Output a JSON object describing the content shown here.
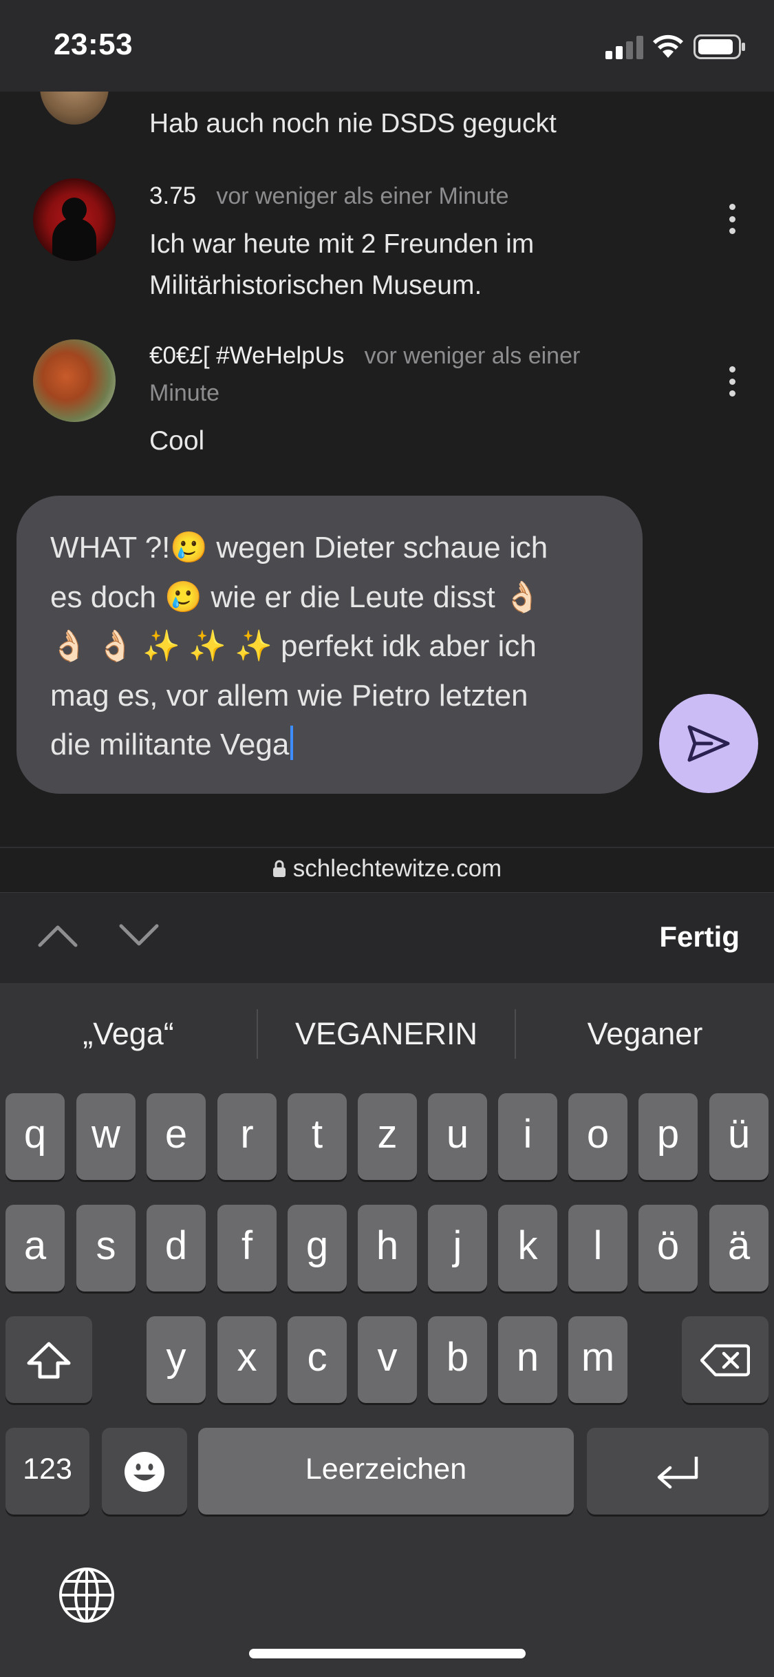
{
  "status_bar": {
    "time": "23:53"
  },
  "comments": [
    {
      "text": "Hab auch noch nie DSDS geguckt"
    },
    {
      "author": "3.75",
      "time": "vor weniger als einer Minute",
      "text_lines": [
        "Ich war heute mit 2 Freunden im",
        "Militärhistorischen Museum."
      ]
    },
    {
      "author": "€0€£[ #WeHelpUs",
      "time_line1": "vor weniger als einer",
      "time_line2": "Minute",
      "text": "Cool"
    }
  ],
  "composer": {
    "lines": [
      "WHAT ?!🥲 wegen Dieter schaue ich",
      "es doch 🥲 wie er die Leute disst 👌🏻",
      "👌🏻 👌🏻 ✨ ✨ ✨ perfekt idk aber ich",
      "mag es, vor allem wie Pietro letzten",
      "die militante Vega"
    ]
  },
  "url_bar": {
    "url": "schlechtewitze.com"
  },
  "accessory": {
    "done_label": "Fertig"
  },
  "keyboard": {
    "suggestions": [
      "„Vega“",
      "VEGANERIN",
      "Veganer"
    ],
    "row1": [
      "q",
      "w",
      "e",
      "r",
      "t",
      "z",
      "u",
      "i",
      "o",
      "p",
      "ü"
    ],
    "row2": [
      "a",
      "s",
      "d",
      "f",
      "g",
      "h",
      "j",
      "k",
      "l",
      "ö",
      "ä"
    ],
    "row3": [
      "y",
      "x",
      "c",
      "v",
      "b",
      "n",
      "m"
    ],
    "numbers_label": "123",
    "space_label": "Leerzeichen"
  },
  "colors": {
    "send_button": "#cbbcf6",
    "caret": "#3e8dff",
    "bubble": "#4b4a4f"
  },
  "icons": [
    "signal-icon",
    "wifi-icon",
    "battery-icon",
    "more-options-icon",
    "send-icon",
    "lock-icon",
    "chevron-up-icon",
    "chevron-down-icon",
    "shift-icon",
    "backspace-icon",
    "emoji-icon",
    "return-icon",
    "globe-icon"
  ]
}
